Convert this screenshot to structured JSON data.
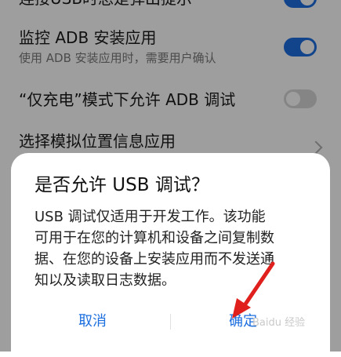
{
  "settings": {
    "rows": [
      {
        "title": "连接USB时总是弹出提示",
        "toggle": "on"
      },
      {
        "title": "监控 ADB 安装应用",
        "subtitle": "使用 ADB 安装应用时，需要用户确认",
        "toggle": "on"
      },
      {
        "title": "“仅充电”模式下允许 ADB 调试",
        "toggle": "off"
      },
      {
        "title": "选择模拟位置信息应用"
      }
    ]
  },
  "dialog": {
    "title": "是否允许 USB 调试？",
    "body_lines": [
      "USB 调试仅适用于开发工作。该功能",
      "可用于在您的计算机和设备之间复制数",
      "据、在您的设备上安装应用而不发送通",
      "知以及读取日志数据。"
    ],
    "cancel_label": "取消",
    "ok_label": "确定"
  },
  "watermark": "Baidu 经验",
  "colors": {
    "accent": "#1d6fe0",
    "toggle_off": "#d7d7d7",
    "annotation_arrow": "#e0201c"
  }
}
